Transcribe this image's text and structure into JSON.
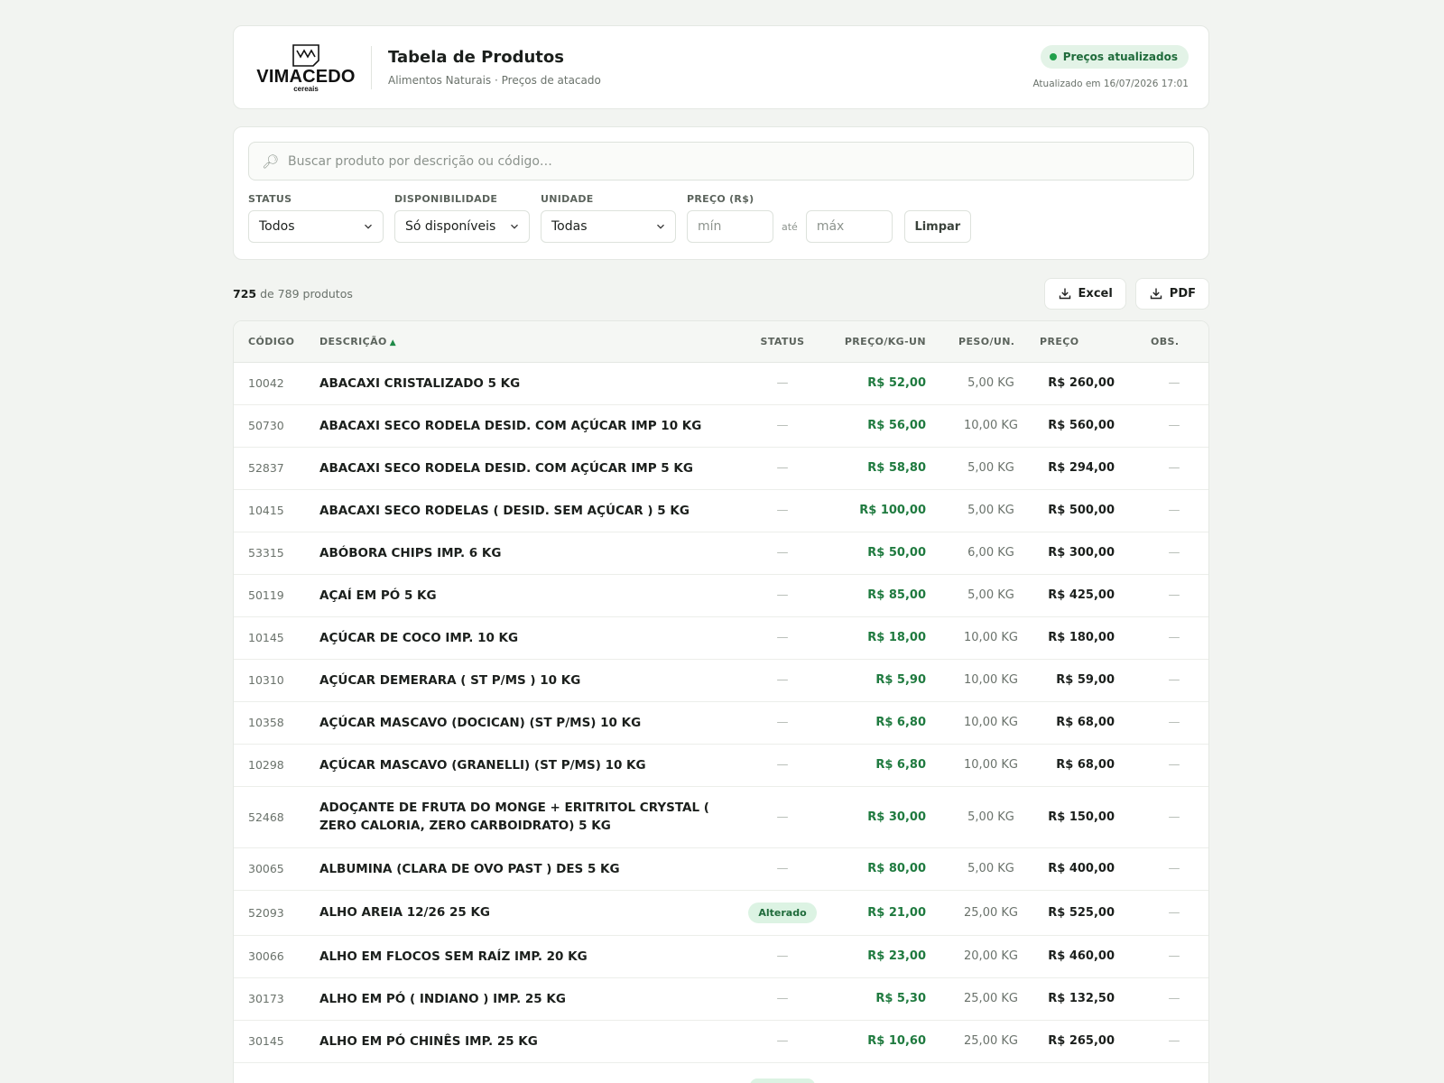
{
  "brand": {
    "name": "VIMACEDO",
    "sub": "cereais",
    "mark": "VM"
  },
  "header": {
    "title": "Tabela de Produtos",
    "subtitle": "Alimentos Naturais · Preços de atacado",
    "status_label": "Preços atualizados",
    "updated_text": "Atualizado em 16/07/2026 17:01"
  },
  "search": {
    "placeholder": "Buscar produto por descrição ou código…",
    "value": ""
  },
  "filters": {
    "status": {
      "label": "STATUS",
      "value": "Todos"
    },
    "availability": {
      "label": "DISPONIBILIDADE",
      "value": "Só disponíveis"
    },
    "unit": {
      "label": "UNIDADE",
      "value": "Todas"
    },
    "price": {
      "label": "PREÇO (R$)",
      "min_placeholder": "mín",
      "max_placeholder": "máx",
      "between": "até"
    },
    "clear_label": "Limpar"
  },
  "results": {
    "shown": "725",
    "text": "de 789 produtos"
  },
  "exports": {
    "excel_label": "Excel",
    "pdf_label": "PDF"
  },
  "table": {
    "headers": {
      "code": "CÓDIGO",
      "description": "DESCRIÇÃO",
      "status": "STATUS",
      "price_per_kg": "PREÇO/KG-UN",
      "weight": "PESO/UN.",
      "price": "PREÇO",
      "obs": "OBS."
    },
    "sort_indicator": "▲",
    "empty": "—",
    "rows": [
      {
        "code": "10042",
        "desc": "ABACAXI CRISTALIZADO 5 KG",
        "status": "",
        "ppk": "R$ 52,00",
        "peso": "5,00 KG",
        "preco": "R$ 260,00",
        "obs": ""
      },
      {
        "code": "50730",
        "desc": "ABACAXI SECO RODELA DESID. COM AÇÚCAR IMP 10 KG",
        "status": "",
        "ppk": "R$ 56,00",
        "peso": "10,00 KG",
        "preco": "R$ 560,00",
        "obs": ""
      },
      {
        "code": "52837",
        "desc": "ABACAXI SECO RODELA DESID. COM AÇÚCAR IMP 5 KG",
        "status": "",
        "ppk": "R$ 58,80",
        "peso": "5,00 KG",
        "preco": "R$ 294,00",
        "obs": ""
      },
      {
        "code": "10415",
        "desc": "ABACAXI SECO RODELAS ( DESID. SEM AÇÚCAR ) 5 KG",
        "status": "",
        "ppk": "R$ 100,00",
        "peso": "5,00 KG",
        "preco": "R$ 500,00",
        "obs": ""
      },
      {
        "code": "53315",
        "desc": "ABÓBORA CHIPS IMP. 6 KG",
        "status": "",
        "ppk": "R$ 50,00",
        "peso": "6,00 KG",
        "preco": "R$ 300,00",
        "obs": ""
      },
      {
        "code": "50119",
        "desc": "AÇAÍ EM PÓ 5 KG",
        "status": "",
        "ppk": "R$ 85,00",
        "peso": "5,00 KG",
        "preco": "R$ 425,00",
        "obs": ""
      },
      {
        "code": "10145",
        "desc": "AÇÚCAR DE COCO IMP. 10 KG",
        "status": "",
        "ppk": "R$ 18,00",
        "peso": "10,00 KG",
        "preco": "R$ 180,00",
        "obs": ""
      },
      {
        "code": "10310",
        "desc": "AÇÚCAR DEMERARA ( ST P/MS ) 10 KG",
        "status": "",
        "ppk": "R$ 5,90",
        "peso": "10,00 KG",
        "preco": "R$ 59,00",
        "obs": ""
      },
      {
        "code": "10358",
        "desc": "AÇÚCAR MASCAVO (DOCICAN) (ST P/MS) 10 KG",
        "status": "",
        "ppk": "R$ 6,80",
        "peso": "10,00 KG",
        "preco": "R$ 68,00",
        "obs": ""
      },
      {
        "code": "10298",
        "desc": "AÇÚCAR MASCAVO (GRANELLI) (ST P/MS) 10 KG",
        "status": "",
        "ppk": "R$ 6,80",
        "peso": "10,00 KG",
        "preco": "R$ 68,00",
        "obs": ""
      },
      {
        "code": "52468",
        "desc": "ADOÇANTE DE FRUTA DO MONGE + ERITRITOL CRYSTAL ( ZERO CALORIA, ZERO CARBOIDRATO) 5 KG",
        "status": "",
        "ppk": "R$ 30,00",
        "peso": "5,00 KG",
        "preco": "R$ 150,00",
        "obs": ""
      },
      {
        "code": "30065",
        "desc": "ALBUMINA (CLARA DE OVO PAST ) DES 5 KG",
        "status": "",
        "ppk": "R$ 80,00",
        "peso": "5,00 KG",
        "preco": "R$ 400,00",
        "obs": ""
      },
      {
        "code": "52093",
        "desc": "ALHO AREIA 12/26 25 KG",
        "status": "Alterado",
        "ppk": "R$ 21,00",
        "peso": "25,00 KG",
        "preco": "R$ 525,00",
        "obs": ""
      },
      {
        "code": "30066",
        "desc": "ALHO EM FLOCOS SEM RAÍZ IMP. 20 KG",
        "status": "",
        "ppk": "R$ 23,00",
        "peso": "20,00 KG",
        "preco": "R$ 460,00",
        "obs": ""
      },
      {
        "code": "30173",
        "desc": "ALHO EM PÓ ( INDIANO ) IMP. 25 KG",
        "status": "",
        "ppk": "R$ 5,30",
        "peso": "25,00 KG",
        "preco": "R$ 132,50",
        "obs": ""
      },
      {
        "code": "30145",
        "desc": "ALHO EM PÓ CHINÊS IMP. 25 KG",
        "status": "",
        "ppk": "R$ 10,60",
        "peso": "25,00 KG",
        "preco": "R$ 265,00",
        "obs": ""
      }
    ]
  },
  "colors": {
    "accent": "#1f7a3f",
    "badge_bg": "#dcf3e3",
    "status_dot": "#21a04b"
  }
}
